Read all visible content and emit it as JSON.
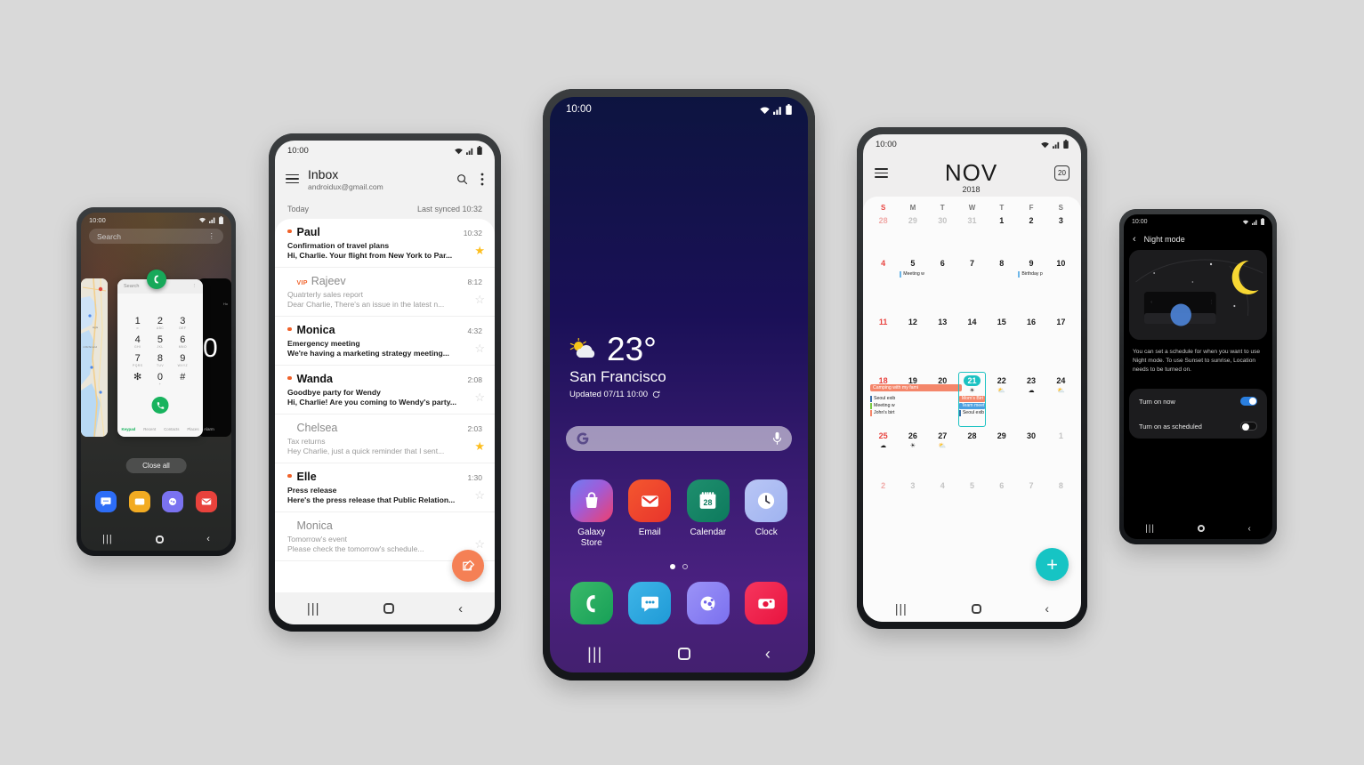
{
  "scene": {
    "background_color": "#d9d9d9"
  },
  "status_bar": {
    "time": "10:00",
    "icons": [
      "wifi-icon",
      "signal-icon",
      "battery-icon"
    ]
  },
  "nav_bar": {
    "recents": "|||",
    "home": "home-icon",
    "back": "‹"
  },
  "phone_recents": {
    "search_placeholder": "Search",
    "overflow": "⋮",
    "close_all_label": "Close all",
    "app_badge": "phone-app-icon",
    "dialer_card": {
      "search_placeholder": "Search",
      "overflow": "⋮",
      "keys": [
        {
          "digit": "1",
          "letters": "∞"
        },
        {
          "digit": "2",
          "letters": "ABC"
        },
        {
          "digit": "3",
          "letters": "DEF"
        },
        {
          "digit": "4",
          "letters": "GHI"
        },
        {
          "digit": "5",
          "letters": "JKL"
        },
        {
          "digit": "6",
          "letters": "MNO"
        },
        {
          "digit": "7",
          "letters": "PQRS"
        },
        {
          "digit": "8",
          "letters": "TUV"
        },
        {
          "digit": "9",
          "letters": "WXYZ"
        },
        {
          "digit": "✻",
          "letters": ""
        },
        {
          "digit": "0",
          "letters": "+"
        },
        {
          "digit": "#",
          "letters": ""
        }
      ],
      "tabs": [
        "Keypad",
        "Recent",
        "Contacts",
        "Places"
      ],
      "active_tab": "Keypad",
      "call_button": "call-icon"
    },
    "clock_card": {
      "digit": "0",
      "alarm_label": "Alarm"
    },
    "dock": [
      "messages-app-icon",
      "gallery-app-icon",
      "contacts-app-icon",
      "email-app-icon"
    ]
  },
  "phone_email": {
    "title": "Inbox",
    "account": "androidux@gmail.com",
    "today_label": "Today",
    "last_synced": "Last synced 10:32",
    "compose_label": "compose-icon",
    "messages": [
      {
        "from": "Paul",
        "time": "10:32",
        "subject": "Confirmation of travel plans",
        "preview": "Hi, Charlie. Your flight from New York to Par...",
        "unread": true,
        "starred": true,
        "vip": false
      },
      {
        "from": "Rajeev",
        "time": "8:12",
        "subject": "Quatrterly sales report",
        "preview": "Dear Charlie, There's an issue in the latest n...",
        "unread": false,
        "starred": false,
        "vip": true,
        "vip_label": "VIP"
      },
      {
        "from": "Monica",
        "time": "4:32",
        "subject": "Emergency meeting",
        "preview": "We're having a marketing strategy meeting...",
        "unread": true,
        "starred": false,
        "vip": false
      },
      {
        "from": "Wanda",
        "time": "2:08",
        "subject": "Goodbye party for Wendy",
        "preview": "Hi, Charlie! Are you coming to Wendy's party...",
        "unread": true,
        "starred": false,
        "vip": false
      },
      {
        "from": "Chelsea",
        "time": "2:03",
        "subject": "Tax returns",
        "preview": "Hey Charlie, just a quick reminder that I sent...",
        "unread": false,
        "starred": true,
        "vip": false
      },
      {
        "from": "Elle",
        "time": "1:30",
        "subject": "Press release",
        "preview": "Here's the press release that Public Relation...",
        "unread": true,
        "starred": false,
        "vip": false
      },
      {
        "from": "Monica",
        "time": "",
        "subject": "Tomorrow's event",
        "preview": "Please check the tomorrow's schedule...",
        "unread": false,
        "starred": false,
        "vip": false
      }
    ]
  },
  "phone_home": {
    "weather": {
      "icon": "partly-cloudy-icon",
      "temperature": "23°",
      "city": "San Francisco",
      "updated": "Updated 07/11 10:00",
      "refresh_icon": "refresh-icon"
    },
    "search": {
      "logo": "google-g-icon",
      "mic": "microphone-icon"
    },
    "apps": [
      {
        "label": "Galaxy Store",
        "icon": "galaxy-store-icon"
      },
      {
        "label": "Email",
        "icon": "email-app-icon"
      },
      {
        "label": "Calendar",
        "icon": "calendar-app-icon",
        "badge": "28"
      },
      {
        "label": "Clock",
        "icon": "clock-app-icon"
      }
    ],
    "page_dots": {
      "total": 2,
      "active": 1
    },
    "dock": [
      "phone-app-icon",
      "messages-app-icon",
      "contacts-app-icon",
      "camera-app-icon"
    ]
  },
  "phone_calendar": {
    "month": "NOV",
    "year": "2018",
    "today_button": "20",
    "day_names": [
      "S",
      "M",
      "T",
      "W",
      "T",
      "F",
      "S"
    ],
    "add_button": "+",
    "weeks": [
      [
        {
          "n": "28",
          "off": true,
          "sun": true
        },
        {
          "n": "29",
          "off": true
        },
        {
          "n": "30",
          "off": true
        },
        {
          "n": "31",
          "off": true
        },
        {
          "n": "1"
        },
        {
          "n": "2"
        },
        {
          "n": "3"
        }
      ],
      [
        {
          "n": "4",
          "sun": true
        },
        {
          "n": "5",
          "events": [
            {
              "text": "Meeting w",
              "style": "line"
            }
          ]
        },
        {
          "n": "6"
        },
        {
          "n": "7"
        },
        {
          "n": "8"
        },
        {
          "n": "9",
          "events": [
            {
              "text": "Birthday p",
              "style": "line"
            }
          ]
        },
        {
          "n": "10"
        }
      ],
      [
        {
          "n": "11",
          "sun": true
        },
        {
          "n": "12"
        },
        {
          "n": "13"
        },
        {
          "n": "14"
        },
        {
          "n": "15"
        },
        {
          "n": "16"
        },
        {
          "n": "17"
        }
      ],
      [
        {
          "n": "18",
          "sun": true,
          "events": [
            {
              "text": "Seoul exib",
              "style": "line-dark"
            },
            {
              "text": "Meeting w",
              "style": "line-green"
            },
            {
              "text": "John's birt",
              "style": "line-orange"
            }
          ]
        },
        {
          "n": "19"
        },
        {
          "n": "20"
        },
        {
          "n": "21",
          "selected": true,
          "weather": "sunny",
          "events": [
            {
              "text": "Mom's Birt",
              "style": "bar-orange"
            },
            {
              "text": "Team meet",
              "style": "bar-blue"
            },
            {
              "text": "Seoul exib",
              "style": "line-dark"
            }
          ]
        },
        {
          "n": "22",
          "weather": "partly"
        },
        {
          "n": "23",
          "weather": "cloudy"
        },
        {
          "n": "24",
          "weather": "partly"
        }
      ],
      [
        {
          "n": "25",
          "sun": true,
          "weather": "cloudy"
        },
        {
          "n": "26",
          "weather": "sunny"
        },
        {
          "n": "27",
          "weather": "partly"
        },
        {
          "n": "28"
        },
        {
          "n": "29"
        },
        {
          "n": "30"
        },
        {
          "n": "1",
          "off": true
        }
      ],
      [
        {
          "n": "2",
          "off": true,
          "sun": true
        },
        {
          "n": "3",
          "off": true
        },
        {
          "n": "4",
          "off": true
        },
        {
          "n": "5",
          "off": true
        },
        {
          "n": "6",
          "off": true
        },
        {
          "n": "7",
          "off": true
        },
        {
          "n": "8",
          "off": true
        }
      ]
    ],
    "multi_day_event": {
      "text": "Camping with my fami",
      "color": "#f4866a"
    }
  },
  "phone_night": {
    "back_icon": "back-chevron-icon",
    "title": "Night mode",
    "hero_icon": "crescent-moon-icon",
    "description": "You can set a schedule for when you want to use Night mode. To use Sunset to sunrise, Location needs to be turned on.",
    "settings": [
      {
        "label": "Turn on now",
        "on": true
      },
      {
        "label": "Turn on as scheduled",
        "on": false
      }
    ]
  },
  "colors": {
    "accent_orange": "#f0622a",
    "accent_teal": "#16c4c4",
    "star_gold": "#fdbe1e",
    "toggle_blue": "#2a7fe0"
  }
}
